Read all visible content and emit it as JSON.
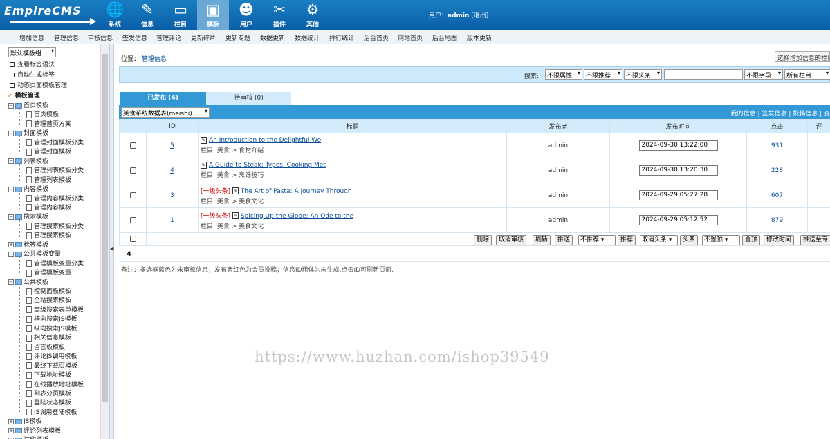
{
  "brand": {
    "logo_text": "EmpireCMS"
  },
  "main_nav": [
    {
      "label": "系统",
      "icon": "globe-icon",
      "glyph": "🌐"
    },
    {
      "label": "信息",
      "icon": "edit-icon",
      "glyph": "✎"
    },
    {
      "label": "栏目",
      "icon": "folder-icon",
      "glyph": "▭"
    },
    {
      "label": "模板",
      "icon": "monitor-icon",
      "glyph": "▣"
    },
    {
      "label": "用户",
      "icon": "user-icon",
      "glyph": "☻"
    },
    {
      "label": "插件",
      "icon": "tools-icon",
      "glyph": "✂"
    },
    {
      "label": "其他",
      "icon": "gear-icon",
      "glyph": "⚙"
    }
  ],
  "user": {
    "prefix": "用户：",
    "name": "admin",
    "logout": "[退出]"
  },
  "sub_nav": [
    "增加信息",
    "管理信息",
    "审核信息",
    "签发信息",
    "管理评论",
    "更新碎片",
    "更新专题",
    "数据更新",
    "数据统计",
    "排行统计",
    "后台首页",
    "网站首页",
    "后台地图",
    "版本更新"
  ],
  "sidebar": {
    "group_select": "默认模板组",
    "quick": [
      "查看标签语法",
      "自动生成标签",
      "动态页面模板管理"
    ],
    "root": "模板管理",
    "tree": [
      {
        "label": "首页模板",
        "children": [
          "首页模板",
          "管理首页方案"
        ]
      },
      {
        "label": "封面模板",
        "children": [
          "管理封面模板分类",
          "管理封面模板"
        ]
      },
      {
        "label": "列表模板",
        "children": [
          "管理列表模板分类",
          "管理列表模板"
        ]
      },
      {
        "label": "内容模板",
        "children": [
          "管理内容模板分类",
          "管理内容模板"
        ]
      },
      {
        "label": "搜索模板",
        "children": [
          "管理搜索模板分类",
          "管理搜索模板"
        ]
      },
      {
        "label": "标签模板",
        "children": []
      },
      {
        "label": "公共模板变量",
        "children": [
          "管理模板变量分类",
          "管理模板变量"
        ]
      },
      {
        "label": "公共模板",
        "children": [
          "控制面板模板",
          "全站搜索模板",
          "高级搜索表单模板",
          "横向搜索JS模板",
          "纵向搜索JS模板",
          "相关信息模板",
          "留言板模板",
          "评论JS调用模板",
          "最终下载页模板",
          "下载地址模板",
          "在线播放地址模板",
          "列表分页模板",
          "登陆状态模板",
          "JS调用登陆模板"
        ]
      },
      {
        "label": "JS模板",
        "children": []
      },
      {
        "label": "评论列表模板",
        "children": []
      },
      {
        "label": "打印模板",
        "children": []
      }
    ]
  },
  "location": {
    "prefix": "位置：",
    "link": "管理信息"
  },
  "select_column_btn": "选择增加信息的栏目",
  "search": {
    "label": "搜索:",
    "selects": [
      "不限属性",
      "不限推荐",
      "不限头条",
      "",
      "不限字段",
      "所有栏目",
      ""
    ]
  },
  "tabs": [
    {
      "label": "已发布 (4)"
    },
    {
      "label": "待审核 (0)"
    }
  ],
  "table_select": "美食系统数据表(meishi)",
  "right_links": {
    "mine": "我的信息",
    "sep": " | ",
    "sign": "签发信息",
    "contrib": "投稿信息",
    "more": " | 查"
  },
  "table": {
    "headers": [
      "",
      "ID",
      "标题",
      "发布者",
      "发布时间",
      "点击",
      "评"
    ],
    "rows": [
      {
        "id": "5",
        "hot": "",
        "title": "An Introduction to the Delightful Wo",
        "column": "栏目: 美食 > 食材介绍",
        "author": "admin",
        "time": "2024-09-30 13:22:00",
        "clicks": "931"
      },
      {
        "id": "4",
        "hot": "",
        "title": "A Guide to Steak: Types, Cooking Met",
        "column": "栏目: 美食 > 烹饪技巧",
        "author": "admin",
        "time": "2024-09-30 13:20:30",
        "clicks": "228"
      },
      {
        "id": "3",
        "hot": "[一级头条]",
        "title": "The Art of Pasta: A Journey Through",
        "column": "栏目: 美食 > 美食文化",
        "author": "admin",
        "time": "2024-09-29 05:27:28",
        "clicks": "607"
      },
      {
        "id": "1",
        "hot": "[一级头条]",
        "title": "Spicing Up the Globe: An Ode to the",
        "column": "栏目: 美食 > 美食文化",
        "author": "admin",
        "time": "2024-09-29 05:12:52",
        "clicks": "879"
      }
    ]
  },
  "actions": [
    {
      "type": "button",
      "label": "删除"
    },
    {
      "type": "button",
      "label": "取消审核"
    },
    {
      "type": "button",
      "label": "刷新"
    },
    {
      "type": "button",
      "label": "推送"
    },
    {
      "type": "select",
      "label": "不推荐"
    },
    {
      "type": "button",
      "label": "推荐"
    },
    {
      "type": "select",
      "label": "取消头条"
    },
    {
      "type": "button",
      "label": "头条"
    },
    {
      "type": "select",
      "label": "不置顶"
    },
    {
      "type": "button",
      "label": "置顶"
    },
    {
      "type": "button",
      "label": "修改时间"
    },
    {
      "type": "button",
      "label": "推送至专"
    }
  ],
  "pager": "4",
  "note": "备注：多选框蓝色为未审核信息；发布者红色为会员投稿；信息ID粗体为未生成,点击ID可刷新页面.",
  "watermark": "https://www.huzhan.com/ishop39549",
  "colors": {
    "header": "#0a5ea8",
    "tab_active": "#3399d6",
    "row_head": "#d3ebfa",
    "hot": "#cc0000"
  }
}
